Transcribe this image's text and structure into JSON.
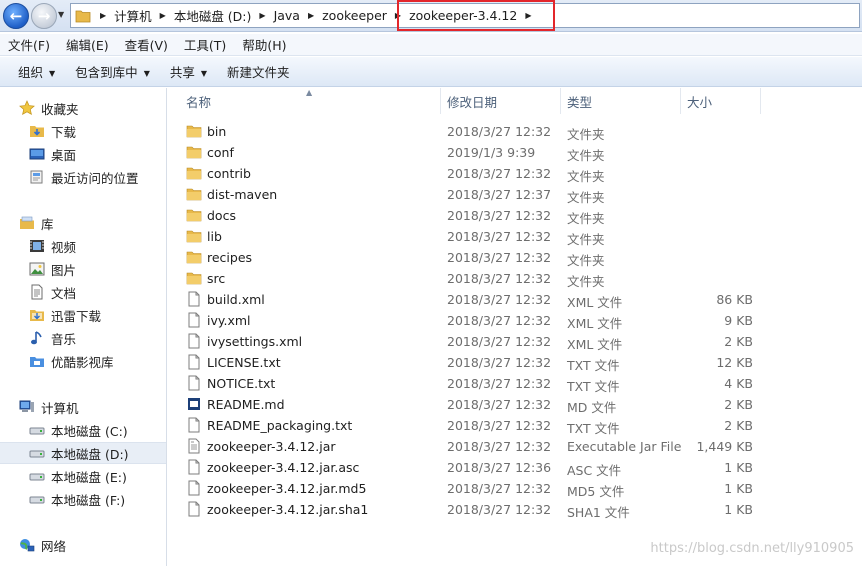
{
  "address": {
    "crumbs": [
      "计算机",
      "本地磁盘 (D:)",
      "Java",
      "zookeeper",
      "zookeeper-3.4.12"
    ]
  },
  "menu": [
    "文件(F)",
    "编辑(E)",
    "查看(V)",
    "工具(T)",
    "帮助(H)"
  ],
  "commands": [
    {
      "label": "组织",
      "dropdown": true
    },
    {
      "label": "包含到库中",
      "dropdown": true
    },
    {
      "label": "共享",
      "dropdown": true
    },
    {
      "label": "新建文件夹",
      "dropdown": false
    }
  ],
  "nav": {
    "favorites": {
      "label": "收藏夹",
      "items": [
        "下载",
        "桌面",
        "最近访问的位置"
      ]
    },
    "libraries": {
      "label": "库",
      "items": [
        "视频",
        "图片",
        "文档",
        "迅雷下载",
        "音乐",
        "优酷影视库"
      ]
    },
    "computer": {
      "label": "计算机",
      "items": [
        "本地磁盘 (C:)",
        "本地磁盘 (D:)",
        "本地磁盘 (E:)",
        "本地磁盘 (F:)"
      ],
      "selected": "本地磁盘 (D:)"
    },
    "network": {
      "label": "网络"
    }
  },
  "columns": {
    "name": "名称",
    "date": "修改日期",
    "type": "类型",
    "size": "大小"
  },
  "files": [
    {
      "name": "bin",
      "date": "2018/3/27 12:32",
      "type": "文件夹",
      "size": "",
      "icon": "folder-icon"
    },
    {
      "name": "conf",
      "date": "2019/1/3 9:39",
      "type": "文件夹",
      "size": "",
      "icon": "folder-icon"
    },
    {
      "name": "contrib",
      "date": "2018/3/27 12:32",
      "type": "文件夹",
      "size": "",
      "icon": "folder-icon"
    },
    {
      "name": "dist-maven",
      "date": "2018/3/27 12:37",
      "type": "文件夹",
      "size": "",
      "icon": "folder-icon"
    },
    {
      "name": "docs",
      "date": "2018/3/27 12:32",
      "type": "文件夹",
      "size": "",
      "icon": "folder-icon"
    },
    {
      "name": "lib",
      "date": "2018/3/27 12:32",
      "type": "文件夹",
      "size": "",
      "icon": "folder-icon"
    },
    {
      "name": "recipes",
      "date": "2018/3/27 12:32",
      "type": "文件夹",
      "size": "",
      "icon": "folder-icon"
    },
    {
      "name": "src",
      "date": "2018/3/27 12:32",
      "type": "文件夹",
      "size": "",
      "icon": "folder-icon"
    },
    {
      "name": "build.xml",
      "date": "2018/3/27 12:32",
      "type": "XML 文件",
      "size": "86 KB",
      "icon": "file-icon"
    },
    {
      "name": "ivy.xml",
      "date": "2018/3/27 12:32",
      "type": "XML 文件",
      "size": "9 KB",
      "icon": "file-icon"
    },
    {
      "name": "ivysettings.xml",
      "date": "2018/3/27 12:32",
      "type": "XML 文件",
      "size": "2 KB",
      "icon": "file-icon"
    },
    {
      "name": "LICENSE.txt",
      "date": "2018/3/27 12:32",
      "type": "TXT 文件",
      "size": "12 KB",
      "icon": "file-icon"
    },
    {
      "name": "NOTICE.txt",
      "date": "2018/3/27 12:32",
      "type": "TXT 文件",
      "size": "4 KB",
      "icon": "file-icon"
    },
    {
      "name": "README.md",
      "date": "2018/3/27 12:32",
      "type": "MD 文件",
      "size": "2 KB",
      "icon": "markdown-file-icon"
    },
    {
      "name": "README_packaging.txt",
      "date": "2018/3/27 12:32",
      "type": "TXT 文件",
      "size": "2 KB",
      "icon": "file-icon"
    },
    {
      "name": "zookeeper-3.4.12.jar",
      "date": "2018/3/27 12:32",
      "type": "Executable Jar File",
      "size": "1,449 KB",
      "icon": "jar-file-icon"
    },
    {
      "name": "zookeeper-3.4.12.jar.asc",
      "date": "2018/3/27 12:36",
      "type": "ASC 文件",
      "size": "1 KB",
      "icon": "file-icon"
    },
    {
      "name": "zookeeper-3.4.12.jar.md5",
      "date": "2018/3/27 12:32",
      "type": "MD5 文件",
      "size": "1 KB",
      "icon": "file-icon"
    },
    {
      "name": "zookeeper-3.4.12.jar.sha1",
      "date": "2018/3/27 12:32",
      "type": "SHA1 文件",
      "size": "1 KB",
      "icon": "file-icon"
    }
  ],
  "watermark": "https://blog.csdn.net/lly910905",
  "colors": {
    "highlight_border": "#e3262b",
    "folder": "#e8b94a",
    "selected_row": "#e8eef6"
  }
}
